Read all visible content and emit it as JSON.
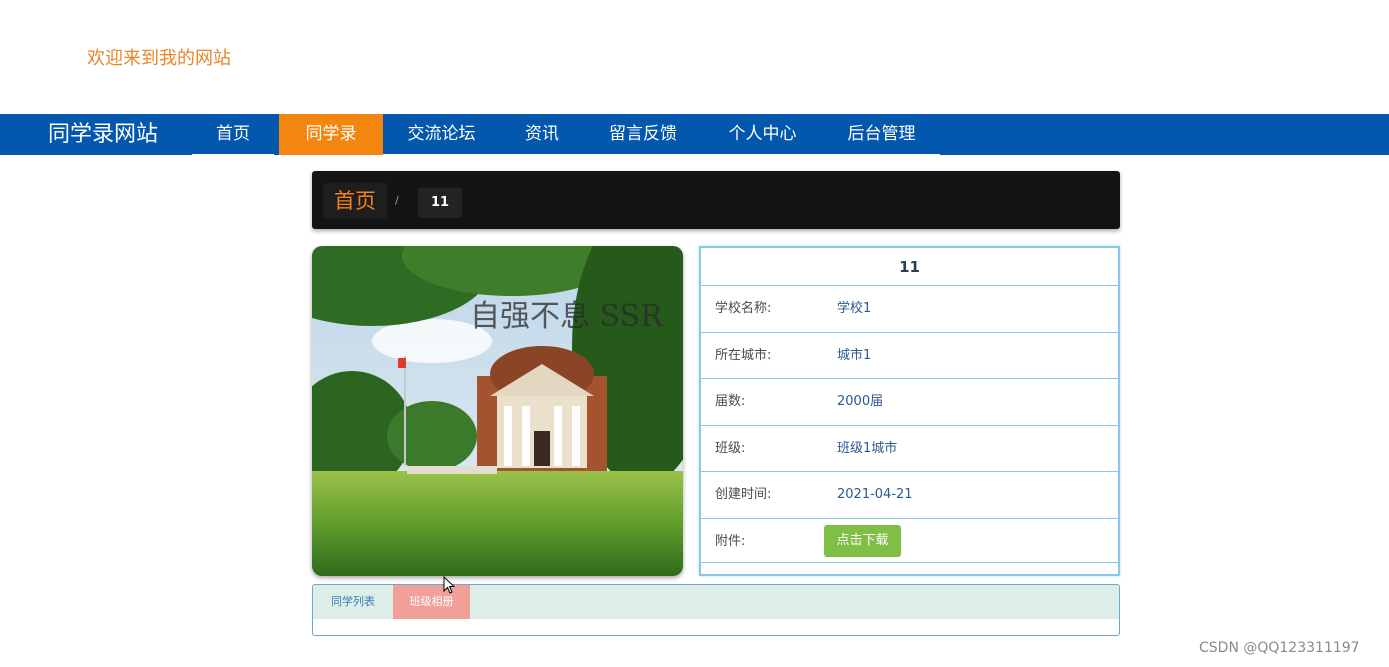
{
  "header": {
    "welcome_text": "欢迎来到我的网站"
  },
  "nav": {
    "brand": "同学录网站",
    "items": [
      {
        "label": "首页"
      },
      {
        "label": "同学录",
        "active": true
      },
      {
        "label": "交流论坛"
      },
      {
        "label": "资讯"
      },
      {
        "label": "留言反馈"
      },
      {
        "label": "个人中心"
      },
      {
        "label": "后台管理"
      }
    ]
  },
  "breadcrumb": {
    "home": "首页",
    "separator": "/",
    "current": "11"
  },
  "detail": {
    "title": "11",
    "photo_caption": "自强不息 SSR",
    "fields": [
      {
        "label": "学校名称:",
        "value": "学校1"
      },
      {
        "label": "所在城市:",
        "value": "城市1"
      },
      {
        "label": "届数:",
        "value": "2000届"
      },
      {
        "label": "班级:",
        "value": "班级1城市"
      },
      {
        "label": "创建时间:",
        "value": "2021-04-21"
      }
    ],
    "attachment": {
      "label": "附件:",
      "button": "点击下载"
    }
  },
  "tabs": [
    {
      "label": "同学列表"
    },
    {
      "label": "班级相册",
      "active": true
    }
  ],
  "watermark": "CSDN @QQ123311197",
  "colors": {
    "nav_bg": "#0357ad",
    "accent_orange": "#f3860f",
    "download_green": "#7fbf45",
    "tab_active": "#f0a098"
  }
}
